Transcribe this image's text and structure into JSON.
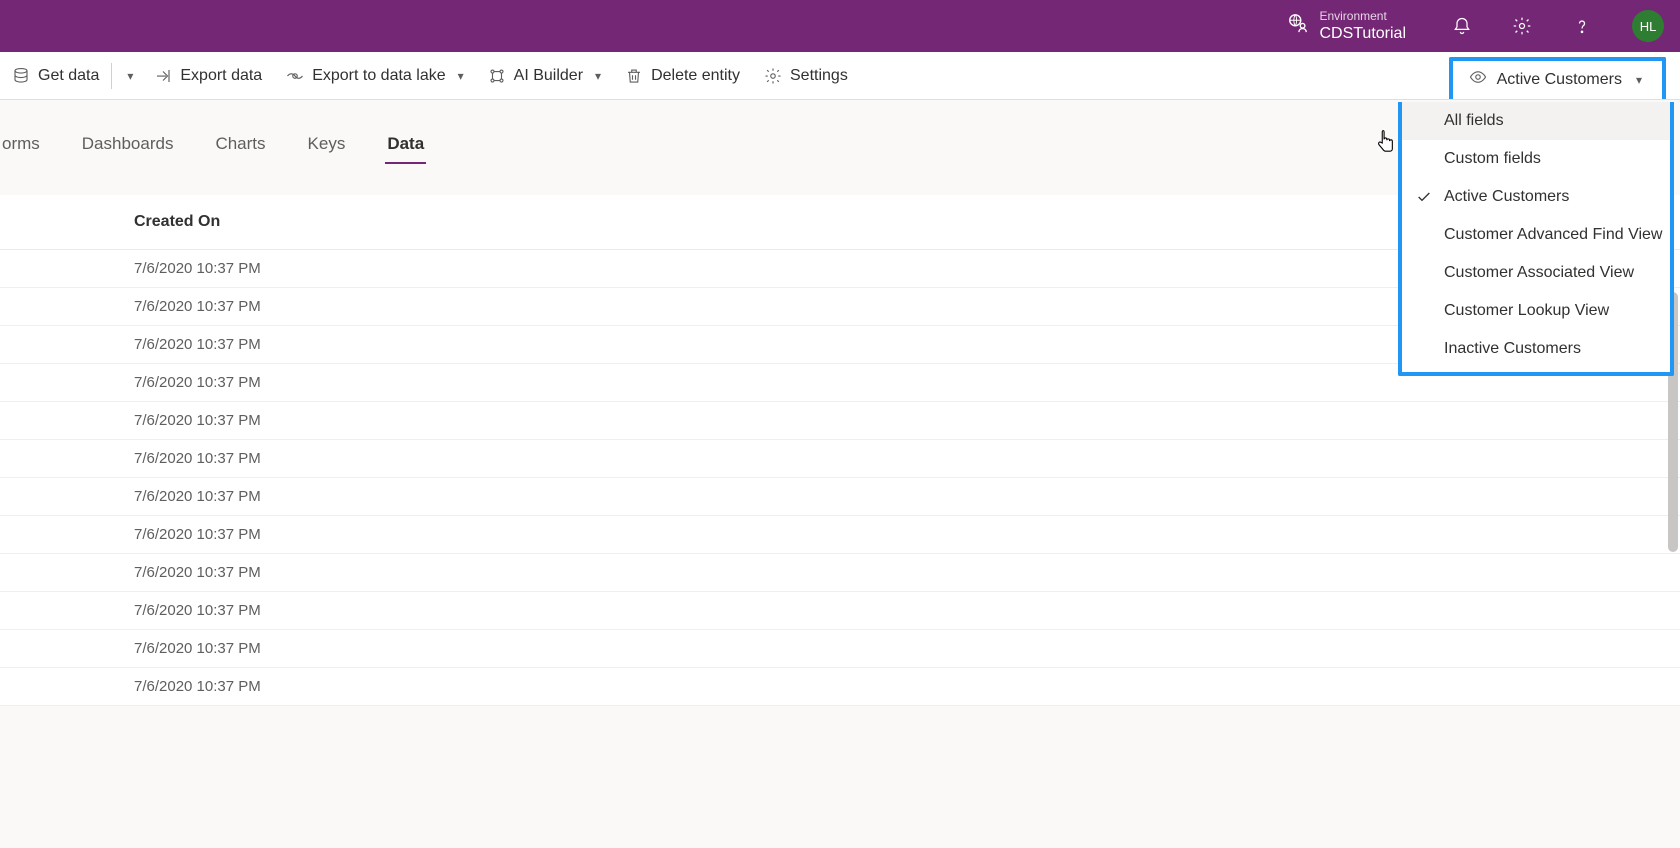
{
  "header": {
    "env_label": "Environment",
    "env_name": "CDSTutorial",
    "avatar_initials": "HL"
  },
  "commands": {
    "get_data": "Get data",
    "export_data": "Export data",
    "export_data_lake": "Export to data lake",
    "ai_builder": "AI Builder",
    "delete_entity": "Delete entity",
    "settings": "Settings"
  },
  "view_switcher": {
    "current": "Active Customers"
  },
  "tabs": {
    "forms": "orms",
    "dashboards": "Dashboards",
    "charts": "Charts",
    "keys": "Keys",
    "data": "Data"
  },
  "table": {
    "column_header": "Created On",
    "rows": [
      "7/6/2020 10:37 PM",
      "7/6/2020 10:37 PM",
      "7/6/2020 10:37 PM",
      "7/6/2020 10:37 PM",
      "7/6/2020 10:37 PM",
      "7/6/2020 10:37 PM",
      "7/6/2020 10:37 PM",
      "7/6/2020 10:37 PM",
      "7/6/2020 10:37 PM",
      "7/6/2020 10:37 PM",
      "7/6/2020 10:37 PM",
      "7/6/2020 10:37 PM"
    ]
  },
  "dropdown": {
    "items": [
      {
        "label": "All fields",
        "selected": false
      },
      {
        "label": "Custom fields",
        "selected": false
      },
      {
        "label": "Active Customers",
        "selected": true
      },
      {
        "label": "Customer Advanced Find View",
        "selected": false
      },
      {
        "label": "Customer Associated View",
        "selected": false
      },
      {
        "label": "Customer Lookup View",
        "selected": false
      },
      {
        "label": "Inactive Customers",
        "selected": false
      }
    ]
  }
}
